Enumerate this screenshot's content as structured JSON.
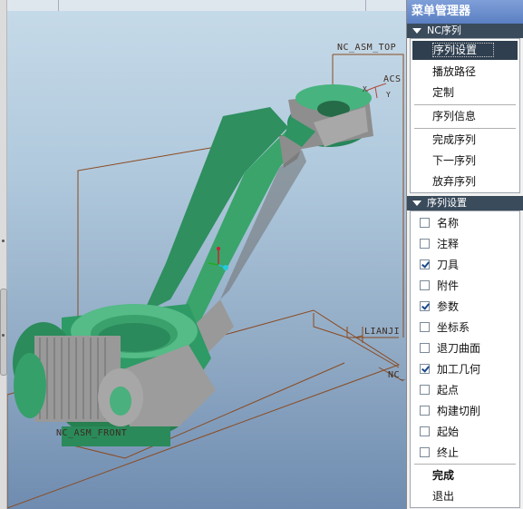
{
  "viewport": {
    "labels": {
      "top_plane": "NC_ASM_TOP",
      "acs": "ACS",
      "acs_axis_x": "X",
      "acs_axis_y": "Y",
      "lianji": "LIANJI",
      "right_plane": "NC_",
      "front_plane": "NC_ASM_FRONT"
    },
    "colors": {
      "part_green": "#35a573",
      "part_gray": "#9a9a9a",
      "datum_lines": "#8a4a20"
    }
  },
  "menu": {
    "title": "菜单管理器",
    "nc_sequence": {
      "header": "NC序列",
      "items": [
        "序列设置",
        "播放路径",
        "定制",
        "序列信息",
        "完成序列",
        "下一序列",
        "放弃序列"
      ],
      "selected": "序列设置"
    },
    "sequence_setup": {
      "header": "序列设置",
      "options": [
        {
          "label": "名称",
          "checked": false
        },
        {
          "label": "注释",
          "checked": false
        },
        {
          "label": "刀具",
          "checked": true
        },
        {
          "label": "附件",
          "checked": false
        },
        {
          "label": "参数",
          "checked": true
        },
        {
          "label": "坐标系",
          "checked": false
        },
        {
          "label": "退刀曲面",
          "checked": false
        },
        {
          "label": "加工几何",
          "checked": true
        },
        {
          "label": "起点",
          "checked": false
        },
        {
          "label": "构建切削",
          "checked": false
        },
        {
          "label": "起始",
          "checked": false
        },
        {
          "label": "终止",
          "checked": false
        }
      ],
      "done": "完成",
      "exit": "退出"
    }
  }
}
